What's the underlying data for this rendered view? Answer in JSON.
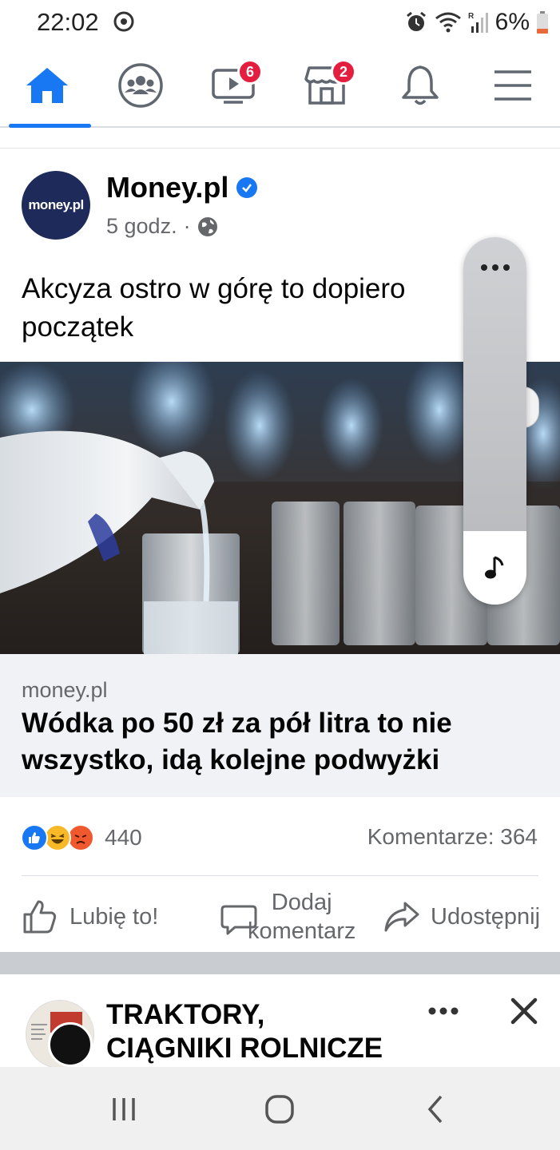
{
  "status_bar": {
    "time": "22:02",
    "battery": "6%",
    "icons": [
      "sync-icon",
      "alarm-icon",
      "wifi-icon",
      "signal-icon",
      "battery-icon"
    ]
  },
  "nav": {
    "items": [
      {
        "name": "home",
        "icon": "home-icon",
        "active": true
      },
      {
        "name": "groups",
        "icon": "groups-icon"
      },
      {
        "name": "watch",
        "icon": "video-icon",
        "badge": "6"
      },
      {
        "name": "marketplace",
        "icon": "marketplace-icon",
        "badge": "2"
      },
      {
        "name": "notifications",
        "icon": "bell-icon"
      },
      {
        "name": "menu",
        "icon": "hamburger-icon"
      }
    ]
  },
  "post": {
    "avatar_text": "money.pl",
    "author": "Money.pl",
    "time": "5 godz.",
    "separator": "·",
    "text": "Akcyza ostro w górę to dopiero początek",
    "link": {
      "domain": "money.pl",
      "title": "Wódka po 50 zł za pół litra to nie wszystko, idą kolejne podwyżki"
    },
    "reaction_count": "440",
    "comments": "Komentarze: 364",
    "actions": {
      "like": "Lubię to!",
      "comment_line1": "Dodaj",
      "comment_line2": "komentarz",
      "share": "Udostępnij"
    }
  },
  "next_post": {
    "title_line1": "TRAKTORY,",
    "title_line2": "CIĄGNIKI ROLNICZE"
  },
  "colors": {
    "accent": "#1877f2",
    "badge": "#e41e3f",
    "muted_text": "#65676b"
  }
}
